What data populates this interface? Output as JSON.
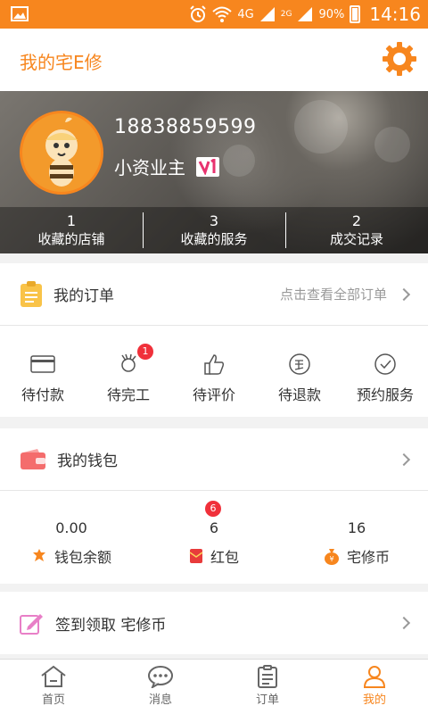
{
  "status_bar": {
    "network_4g": "4G",
    "sim1": "4G",
    "sim2": "2G",
    "battery": "90%",
    "time": "14:16"
  },
  "header": {
    "title": "我的宅E修",
    "settings_icon": "gear-icon"
  },
  "profile": {
    "phone": "18838859599",
    "nickname": "小资业主",
    "stats": [
      {
        "value": "1",
        "label": "收藏的店铺"
      },
      {
        "value": "3",
        "label": "收藏的服务"
      },
      {
        "value": "2",
        "label": "成交记录"
      }
    ]
  },
  "orders": {
    "title": "我的订单",
    "hint": "点击查看全部订单",
    "items": [
      {
        "label": "待付款",
        "icon": "card-icon"
      },
      {
        "label": "待完工",
        "icon": "hand-ok-icon",
        "badge": "1"
      },
      {
        "label": "待评价",
        "icon": "thumb-up-icon"
      },
      {
        "label": "待退款",
        "icon": "refund-icon"
      },
      {
        "label": "预约服务",
        "icon": "clock-icon"
      }
    ]
  },
  "wallet": {
    "title": "我的钱包",
    "items": [
      {
        "value": "0.00",
        "label": "钱包余额",
        "icon": "balance-icon"
      },
      {
        "value": "6",
        "label": "红包",
        "icon": "red-packet-icon",
        "badge": "6"
      },
      {
        "value": "16",
        "label": "宅修币",
        "icon": "coin-bag-icon"
      }
    ]
  },
  "checkin": {
    "title": "签到领取 宅修币"
  },
  "tabs": [
    {
      "label": "首页",
      "icon": "home-icon"
    },
    {
      "label": "消息",
      "icon": "message-icon"
    },
    {
      "label": "订单",
      "icon": "order-icon"
    },
    {
      "label": "我的",
      "icon": "profile-icon",
      "active": true
    }
  ],
  "colors": {
    "accent": "#f7861e",
    "badge": "#f0303a"
  }
}
